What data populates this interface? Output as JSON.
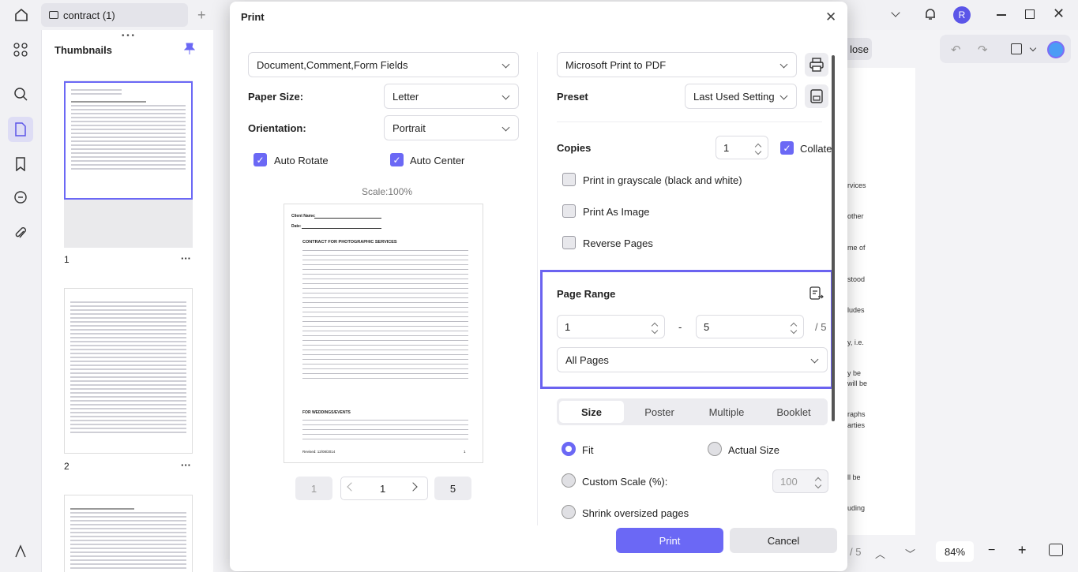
{
  "tab": {
    "title": "contract (1)"
  },
  "topbar": {
    "avatar": "R"
  },
  "thumbnails": {
    "title": "Thumbnails",
    "page1": "1",
    "page2": "2",
    "more": "···"
  },
  "background_doc": {
    "close_label": "lose",
    "zoom": "84%",
    "page_total": "/ 5",
    "fragments": [
      "rvices",
      "other",
      "me of",
      "stood",
      "ludes",
      "y, i.e.",
      "y be",
      "will be",
      "raphs",
      "arties",
      "ll be",
      "uding"
    ]
  },
  "dialog": {
    "title": "Print",
    "content_select": "Document,Comment,Form Fields",
    "paper_size_label": "Paper Size:",
    "paper_size": "Letter",
    "orientation_label": "Orientation:",
    "orientation": "Portrait",
    "auto_rotate": "Auto Rotate",
    "auto_center": "Auto Center",
    "scale": "Scale:100%",
    "preview": {
      "client_name": "Client Name:",
      "date": "Date:",
      "heading": "CONTRACT FOR PHOTOGRAPHIC SERVICES",
      "subheading": "FOR WEDDINGS/EVENTS",
      "footer": "Revised: 12/08/2014",
      "page_no": "1"
    },
    "nav": {
      "first": "1",
      "current": "1",
      "last": "5"
    },
    "printer": "Microsoft Print to PDF",
    "preset_label": "Preset",
    "preset": "Last Used Setting",
    "copies_label": "Copies",
    "copies": "1",
    "collate": "Collate",
    "grayscale": "Print in grayscale (black and white)",
    "as_image": "Print As Image",
    "reverse": "Reverse Pages",
    "page_range_label": "Page Range",
    "range_from": "1",
    "range_dash": "-",
    "range_to": "5",
    "range_total": "/ 5",
    "range_mode": "All Pages",
    "size_tabs": [
      "Size",
      "Poster",
      "Multiple",
      "Booklet"
    ],
    "fit": "Fit",
    "actual_size": "Actual Size",
    "custom_scale": "Custom Scale (%):",
    "custom_scale_value": "100",
    "shrink": "Shrink oversized pages",
    "print_btn": "Print",
    "cancel_btn": "Cancel"
  },
  "colors": {
    "accent": "#6b68f5",
    "highlight_border": "#6b63f0"
  }
}
